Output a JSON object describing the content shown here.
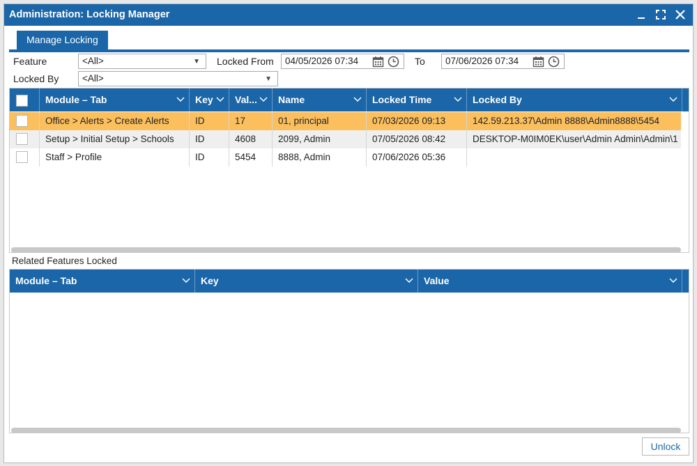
{
  "window": {
    "title": "Administration: Locking Manager"
  },
  "tabs": [
    {
      "label": "Manage Locking"
    }
  ],
  "filters": {
    "feature_label": "Feature",
    "feature_value": "<All>",
    "locked_from_label": "Locked From",
    "locked_from_value": "04/05/2026 07:34",
    "to_label": "To",
    "to_value": "07/06/2026 07:34",
    "locked_by_label": "Locked By",
    "locked_by_value": "<All>"
  },
  "locks_grid": {
    "columns": [
      "Module – Tab",
      "Key",
      "Val...",
      "Name",
      "Locked Time",
      "Locked By"
    ],
    "rows": [
      {
        "module_tab": "Office > Alerts > Create Alerts",
        "key": "ID",
        "value": "17",
        "name": "01, principal",
        "locked_time": "07/03/2026 09:13",
        "locked_by": "142.59.213.37\\Admin 8888\\Admin8888\\5454",
        "selected": true
      },
      {
        "module_tab": "Setup > Initial Setup > Schools",
        "key": "ID",
        "value": "4608",
        "name": "2099, Admin",
        "locked_time": "07/05/2026 08:42",
        "locked_by": "DESKTOP-M0IM0EK\\user\\Admin Admin\\Admin\\1",
        "selected": false
      },
      {
        "module_tab": "Staff > Profile",
        "key": "ID",
        "value": "5454",
        "name": "8888, Admin",
        "locked_time": "07/06/2026 05:36",
        "locked_by": "",
        "selected": false
      }
    ]
  },
  "related": {
    "label": "Related Features Locked",
    "columns": [
      "Module – Tab",
      "Key",
      "Value"
    ]
  },
  "actions": {
    "unlock_label": "Unlock"
  },
  "colors": {
    "header": "#1a66a8",
    "selected_row": "#fbbf5e",
    "alt_row": "#efefef"
  }
}
